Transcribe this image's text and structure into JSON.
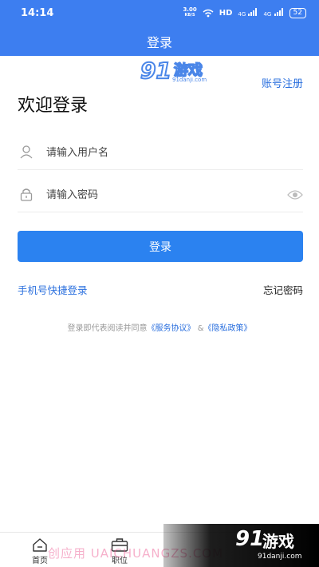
{
  "status_bar": {
    "time": "14:14",
    "net_speed_value": "3.00",
    "net_speed_unit": "KB/S",
    "hd_label": "HD",
    "signal_1": "4G",
    "signal_2": "4G",
    "battery": "52"
  },
  "nav": {
    "title": "登录"
  },
  "top_logo": {
    "number": "91",
    "text": "游戏",
    "url": "91danji.com"
  },
  "header": {
    "register_link": "账号注册",
    "welcome": "欢迎登录"
  },
  "form": {
    "username_placeholder": "请输入用户名",
    "password_placeholder": "请输入密码",
    "login_button": "登录"
  },
  "links": {
    "quick_login": "手机号快捷登录",
    "forgot_password": "忘记密码"
  },
  "agreement": {
    "prefix": "登录即代表阅读并同意",
    "service": "《服务协议》",
    "connector": "&",
    "privacy": "《隐私政策》"
  },
  "tabs": [
    {
      "label": "首页",
      "icon": "home-icon"
    },
    {
      "label": "职位",
      "icon": "briefcase-icon"
    }
  ],
  "watermarks": {
    "overlay_text": "创应用 UAICHUANGZS.COM",
    "logo_number": "91",
    "logo_text": "游戏",
    "logo_url": "91danji.com"
  },
  "colors": {
    "primary": "#3d7ef0",
    "button": "#2b82f0",
    "link": "#2a6fde"
  }
}
